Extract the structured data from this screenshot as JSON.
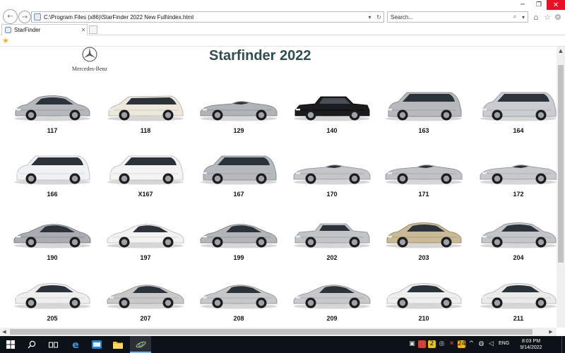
{
  "browser": {
    "address_url": "C:\\Program Files (x86)\\StarFinder 2022 New Full\\index.html",
    "search_placeholder": "Search...",
    "tab_title": "StarFinder",
    "win_minimize": "─",
    "win_maximize": "❐",
    "win_close": "✕"
  },
  "page": {
    "logo_text": "Mercedes-Benz",
    "title": "Starfinder 2022"
  },
  "models": [
    {
      "code": "117",
      "body": "sedan",
      "color": "#b5b8bc"
    },
    {
      "code": "118",
      "body": "wagon",
      "color": "#ece8dc"
    },
    {
      "code": "129",
      "body": "roadster",
      "color": "#b0b3b7"
    },
    {
      "code": "140",
      "body": "sedan-classic",
      "color": "#1b1c1e"
    },
    {
      "code": "163",
      "body": "suv",
      "color": "#b7b9bc"
    },
    {
      "code": "164",
      "body": "suv",
      "color": "#c9ccd0"
    },
    {
      "code": "166",
      "body": "suv",
      "color": "#f1f2f3"
    },
    {
      "code": "X167",
      "body": "suv",
      "color": "#f4f4f4"
    },
    {
      "code": "167",
      "body": "suv",
      "color": "#b6b9bd"
    },
    {
      "code": "170",
      "body": "roadster",
      "color": "#c4c6c9"
    },
    {
      "code": "171",
      "body": "roadster",
      "color": "#c0c3c6"
    },
    {
      "code": "172",
      "body": "roadster",
      "color": "#c7c9cc"
    },
    {
      "code": "190",
      "body": "coupe",
      "color": "#a9acb0"
    },
    {
      "code": "197",
      "body": "coupe",
      "color": "#f2f2f2"
    },
    {
      "code": "199",
      "body": "coupe",
      "color": "#b3b5b8"
    },
    {
      "code": "202",
      "body": "sedan-classic",
      "color": "#c2c4c7"
    },
    {
      "code": "203",
      "body": "sedan",
      "color": "#c9b994"
    },
    {
      "code": "204",
      "body": "sedan",
      "color": "#c3c5c8"
    },
    {
      "code": "205",
      "body": "sedan",
      "color": "#eeeeee"
    },
    {
      "code": "207",
      "body": "coupe",
      "color": "#c8c8c8"
    },
    {
      "code": "208",
      "body": "coupe",
      "color": "#c6c7c9"
    },
    {
      "code": "209",
      "body": "coupe",
      "color": "#c7c8ca"
    },
    {
      "code": "210",
      "body": "sedan",
      "color": "#eeeeef"
    },
    {
      "code": "211",
      "body": "sedan",
      "color": "#eaeaea"
    }
  ],
  "taskbar": {
    "lang": "ENG",
    "time": "8:03 PM",
    "date": "9/14/2022"
  }
}
